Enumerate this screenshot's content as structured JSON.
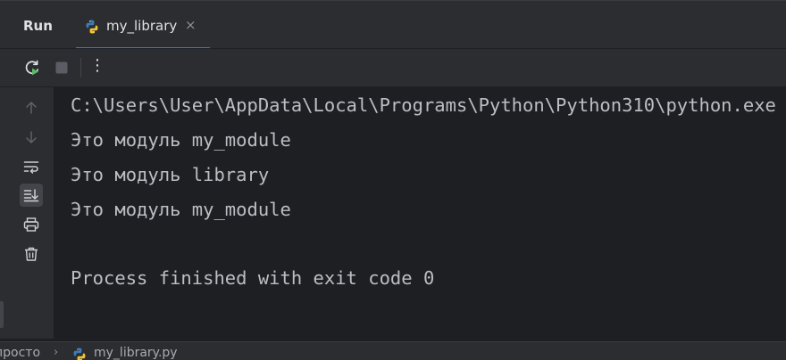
{
  "header": {
    "title": "Run",
    "tabs": [
      {
        "label": "my_library",
        "close": "×",
        "icon": "python-icon"
      }
    ]
  },
  "toolbar": {
    "rerun": "rerun-icon",
    "stop": "stop-icon",
    "more": "⋮"
  },
  "gutter": {
    "icons": [
      "up-arrow-icon",
      "down-arrow-icon",
      "soft-wrap-icon",
      "scroll-to-end-icon",
      "print-icon",
      "trash-icon"
    ]
  },
  "console": {
    "lines": [
      "C:\\Users\\User\\AppData\\Local\\Programs\\Python\\Python310\\python.exe",
      "Это модуль my_module",
      "Это модуль library",
      "Это модуль my_module",
      "",
      "Process finished with exit code 0"
    ]
  },
  "statusbar": {
    "crumb_folder": "просто",
    "crumb_sep": "›",
    "crumb_file": "my_library.py"
  },
  "colors": {
    "accent": "#3574f0",
    "background": "#1e1f22",
    "panel": "#2b2d30",
    "text": "#bcbec4",
    "run_green": "#5fb865"
  }
}
